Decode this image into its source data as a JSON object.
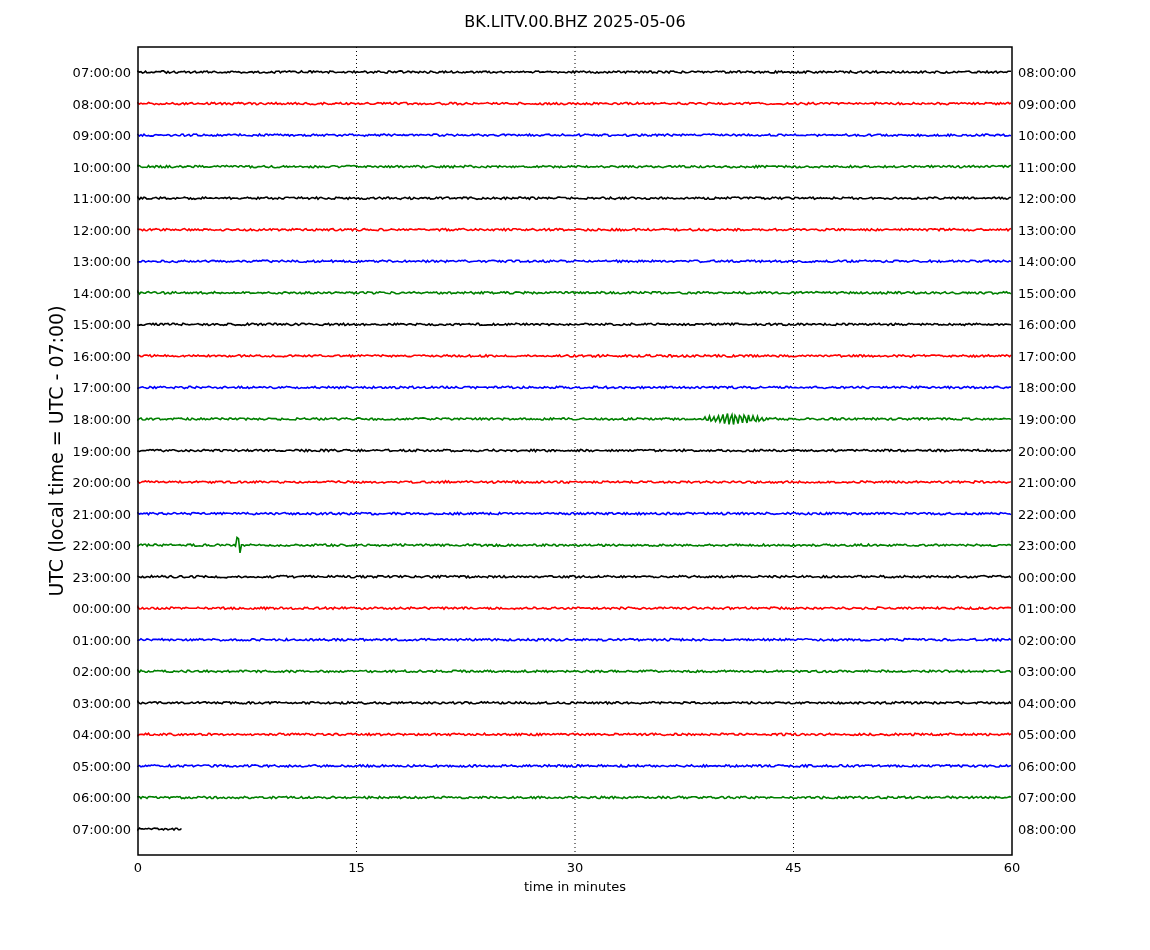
{
  "title": "BK.LITV.00.BHZ 2025-05-06",
  "ylabel": "UTC (local time = UTC - 07:00)",
  "xlabel": "time in minutes",
  "xticks": [
    "0",
    "15",
    "30",
    "45",
    "60"
  ],
  "rows": [
    {
      "left": "07:00:00",
      "right": "08:00:00",
      "color": "#000000",
      "kind": "noise",
      "level": 1
    },
    {
      "left": "08:00:00",
      "right": "09:00:00",
      "color": "#ff0000",
      "kind": "noise",
      "level": 1
    },
    {
      "left": "09:00:00",
      "right": "10:00:00",
      "color": "#0000ff",
      "kind": "noise",
      "level": 1
    },
    {
      "left": "10:00:00",
      "right": "11:00:00",
      "color": "#008000",
      "kind": "noise",
      "level": 1
    },
    {
      "left": "11:00:00",
      "right": "12:00:00",
      "color": "#000000",
      "kind": "noise",
      "level": 1
    },
    {
      "left": "12:00:00",
      "right": "13:00:00",
      "color": "#ff0000",
      "kind": "noise",
      "level": 1
    },
    {
      "left": "13:00:00",
      "right": "14:00:00",
      "color": "#0000ff",
      "kind": "noise",
      "level": 1
    },
    {
      "left": "14:00:00",
      "right": "15:00:00",
      "color": "#008000",
      "kind": "noise",
      "level": 1
    },
    {
      "left": "15:00:00",
      "right": "16:00:00",
      "color": "#000000",
      "kind": "noise",
      "level": 1
    },
    {
      "left": "16:00:00",
      "right": "17:00:00",
      "color": "#ff0000",
      "kind": "noise",
      "level": 1
    },
    {
      "left": "17:00:00",
      "right": "18:00:00",
      "color": "#0000ff",
      "kind": "noise",
      "level": 1
    },
    {
      "left": "18:00:00",
      "right": "19:00:00",
      "color": "#008000",
      "kind": "quake",
      "level": 1
    },
    {
      "left": "19:00:00",
      "right": "20:00:00",
      "color": "#000000",
      "kind": "noise",
      "level": 1
    },
    {
      "left": "20:00:00",
      "right": "21:00:00",
      "color": "#ff0000",
      "kind": "noise",
      "level": 1
    },
    {
      "left": "21:00:00",
      "right": "22:00:00",
      "color": "#0000ff",
      "kind": "noise",
      "level": 1
    },
    {
      "left": "22:00:00",
      "right": "23:00:00",
      "color": "#008000",
      "kind": "spike",
      "level": 1
    },
    {
      "left": "23:00:00",
      "right": "00:00:00",
      "color": "#000000",
      "kind": "noise",
      "level": 1
    },
    {
      "left": "00:00:00",
      "right": "01:00:00",
      "color": "#ff0000",
      "kind": "noise",
      "level": 1
    },
    {
      "left": "01:00:00",
      "right": "02:00:00",
      "color": "#0000ff",
      "kind": "noise",
      "level": 1
    },
    {
      "left": "02:00:00",
      "right": "03:00:00",
      "color": "#008000",
      "kind": "noise",
      "level": 1
    },
    {
      "left": "03:00:00",
      "right": "04:00:00",
      "color": "#000000",
      "kind": "noise",
      "level": 1
    },
    {
      "left": "04:00:00",
      "right": "05:00:00",
      "color": "#ff0000",
      "kind": "noise",
      "level": 1
    },
    {
      "left": "05:00:00",
      "right": "06:00:00",
      "color": "#0000ff",
      "kind": "noise",
      "level": 1
    },
    {
      "left": "06:00:00",
      "right": "07:00:00",
      "color": "#008000",
      "kind": "noise",
      "level": 1
    },
    {
      "left": "07:00:00",
      "right": "08:00:00",
      "color": "#000000",
      "kind": "noise",
      "level": 0.05
    }
  ]
}
